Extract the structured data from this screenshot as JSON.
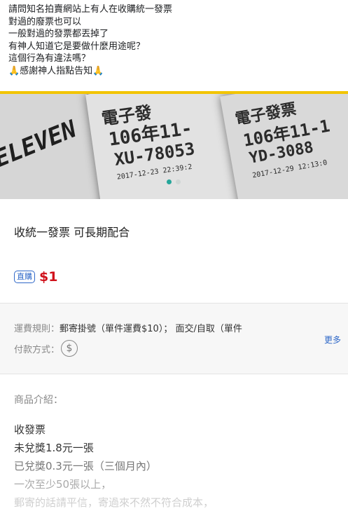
{
  "post": {
    "lines": [
      "請問知名拍賣網站上有人在收購統一發票",
      "對過的廢票也可以",
      "一般對過的發票都丟掉了",
      "有神人知道它是要做什麼用途呢？",
      "這個行為有違法嗎？",
      "🙏感謝神人指點告知🙏"
    ]
  },
  "photo": {
    "receipt_texts": {
      "left_brand": "ELEVEN",
      "r2_head": "電子發",
      "r2_year": "106年11-",
      "r2_code": "XU-78053",
      "r2_date": "2017-12-23 22:39:2",
      "r3_head": "電子發票",
      "r3_year": "106年11-1",
      "r3_code": "YD-3088",
      "r3_date": "2017-12-29 12:13:0"
    },
    "carousel_active_index": 0
  },
  "listing": {
    "title": "收統一發票 可長期配合",
    "badge": "直購",
    "price": "$1"
  },
  "shipping": {
    "label": "運費規則：",
    "value": "郵寄掛號（單件運費$10）； 面交/自取（單件",
    "payment_label": "付款方式：",
    "payment_icon": "$",
    "more": "更多"
  },
  "description": {
    "header": "商品介紹：",
    "lines": [
      "收發票",
      "未兌獎1.8元一張",
      "已兌獎0.3元一張（三個月內）",
      "一次至少50張以上，",
      "郵寄的話請平信，寄過來不然不符合成本，"
    ]
  },
  "colors": {
    "accent_bar": "#f2c400",
    "price": "#d0121c",
    "link": "#2f68c8",
    "carousel_active": "#26a69a"
  }
}
